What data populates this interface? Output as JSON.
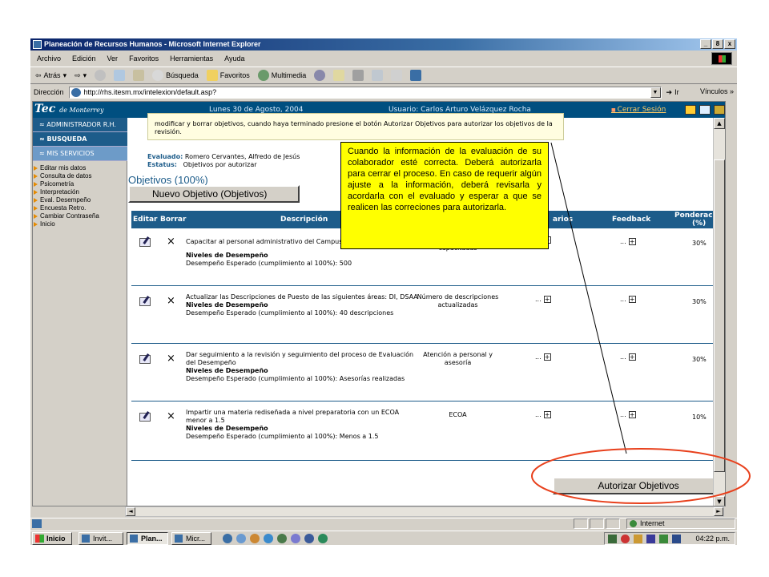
{
  "window": {
    "title": "Planeación de Recursos Humanos - Microsoft Internet Explorer",
    "controls": [
      "_",
      "8",
      "x"
    ]
  },
  "menubar": [
    "Archivo",
    "Edición",
    "Ver",
    "Favoritos",
    "Herramientas",
    "Ayuda"
  ],
  "toolbar": {
    "back": "Atrás",
    "search": "Búsqueda",
    "favorites": "Favoritos",
    "multimedia": "Multimedia"
  },
  "address": {
    "label": "Dirección",
    "url": "http://rhs.itesm.mx/intelexion/default.asp?",
    "go": "Ir",
    "links": "Vínculos"
  },
  "header": {
    "brand": "Tec",
    "brand_sub": "de Monterrey",
    "date": "Lunes 30 de Agosto, 2004",
    "user": "Usuario: Carlos Arturo Velázquez Rocha",
    "logout": "Cerrar Sesión"
  },
  "sidebar": {
    "sections": [
      "ADMINISTRADOR R.H.",
      "BUSQUEDA",
      "MIS SERVICIOS"
    ],
    "section_marks": [
      "≈",
      "≈",
      "≈"
    ],
    "items": [
      "Editar mis datos",
      "Consulta de datos",
      "Psicometría",
      "Interpretación",
      "Eval. Desempeño",
      "Encuesta Retro.",
      "Cambiar Contraseña",
      "Inicio"
    ]
  },
  "main": {
    "note": "modificar y borrar objetivos, cuando haya terminado presione el botón Autorizar Objetivos para autorizar los objetivos de la revisión.",
    "evaluado_label": "Evaluado:",
    "evaluado_value": "Romero Cervantes, Alfredo de Jesús",
    "estatus_label": "Estatus:",
    "estatus_value": "Objetivos por autorizar",
    "objetivos_title": "Objetivos (100%)",
    "new_button": "Nuevo Objetivo (Objetivos)",
    "authorize_button": "Autorizar Objetivos"
  },
  "table": {
    "headers": {
      "editar": "Editar",
      "borrar": "Borrar",
      "descripcion": "Descripción",
      "comentarios": "arios",
      "feedback": "Feedback",
      "ponderacion": "Ponderación",
      "ponderacion_unit": "(%)"
    },
    "rows": [
      {
        "desc": "Capacitar al personal administrativo del Campus",
        "niveles": "Niveles de Desempeño",
        "esperado": "Desempeño Esperado (cumplimiento al 100%): 500",
        "indicador": "capacitadas",
        "com": "...",
        "fb": "...",
        "pond": "30%"
      },
      {
        "desc": "Actualizar las Descripciones de Puesto de las siguientes áreas: DI, DSAA",
        "niveles": "Niveles de Desempeño",
        "esperado": "Desempeño Esperado (cumplimiento al 100%): 40 descripciones",
        "indicador": "Número de descripciones actualizadas",
        "com": "...",
        "fb": "...",
        "pond": "30%"
      },
      {
        "desc": "Dar seguimiento a la revisión y seguimiento del proceso de Evaluación del Desempeño",
        "niveles": "Niveles de Desempeño",
        "esperado": "Desempeño Esperado (cumplimiento al 100%): Asesorías realizadas",
        "indicador": "Atención a personal y asesoría",
        "com": "...",
        "fb": "...",
        "pond": "30%"
      },
      {
        "desc": "Impartir una materia rediseñada a nivel preparatoria con un ECOA menor a 1.5",
        "niveles": "Niveles de Desempeño",
        "esperado": "Desempeño Esperado (cumplimiento al 100%): Menos a 1.5",
        "indicador": "ECOA",
        "com": "...",
        "fb": "...",
        "pond": "10%"
      }
    ],
    "row_marks": {
      "delete": "×",
      "expand": "+"
    }
  },
  "statusbar": {
    "zone": "Internet"
  },
  "taskbar": {
    "start": "Inicio",
    "tasks": [
      "Invit...",
      "Plan...",
      "Micr..."
    ],
    "clock": "04:22 p.m."
  },
  "callout": {
    "text": "Cuando la información de la evaluación de su colaborador esté correcta. Deberá autorizarla para cerrar el proceso. En caso de requerir algún ajuste a la información, deberá revisarla y acordarla con el evaluado y esperar a que se realicen las correciones para autorizarla."
  },
  "colors": {
    "header_blue": "#004f80",
    "table_blue": "#1d5c8a",
    "callout_yellow": "#ffff00",
    "highlight_red": "#e8401c"
  }
}
